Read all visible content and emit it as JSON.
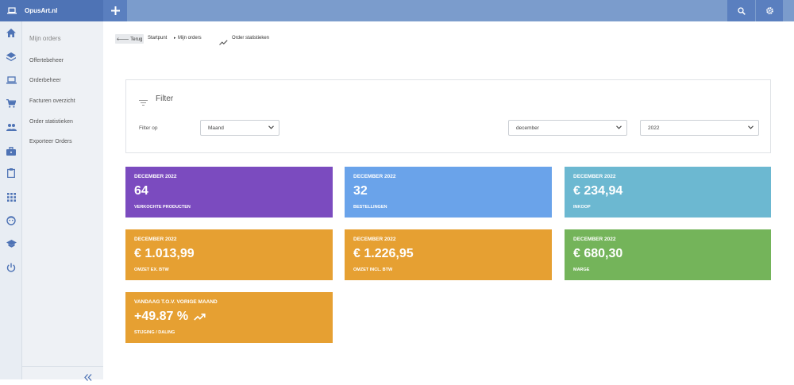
{
  "app": {
    "brand": "OpusArt.nl"
  },
  "topbar": {
    "add_icon": "plus-icon",
    "search_icon": "search-icon",
    "settings_icon": "gear-icon"
  },
  "rail": [
    "home-icon",
    "layers-icon",
    "laptop-icon",
    "cart-icon",
    "users-icon",
    "briefcase-icon",
    "clipboard-icon",
    "apps-icon",
    "face-icon",
    "school-icon",
    "power-icon"
  ],
  "subnav": {
    "title": "Mijn orders",
    "items": [
      "Offertebeheer",
      "Orderbeheer",
      "Facturen overzicht",
      "Order statistieken",
      "Exporteer Orders"
    ],
    "collapse_icon": "double-chevron-left-icon"
  },
  "breadcrumb": {
    "back": "🡐 Terug",
    "crumbs": [
      "Startpunt",
      "Mijn orders"
    ],
    "separator": "▸",
    "current": "Order statistieken"
  },
  "filter": {
    "title": "Filter",
    "label": "Filter op",
    "period_type": "Maand",
    "month": "december",
    "year": "2022"
  },
  "tiles": [
    {
      "period": "DECEMBER 2022",
      "value": "64",
      "label": "VERKOCHTE PRODUCTEN",
      "color": "#7b4bbf"
    },
    {
      "period": "DECEMBER 2022",
      "value": "32",
      "label": "BESTELLINGEN",
      "color": "#6aa3ea"
    },
    {
      "period": "DECEMBER 2022",
      "value": "€ 234,94",
      "label": "INKOOP",
      "color": "#6cb8d1"
    },
    {
      "period": "DECEMBER 2022",
      "value": "€ 1.013,99",
      "label": "OMZET EX. BTW",
      "color": "#e6a032"
    },
    {
      "period": "DECEMBER 2022",
      "value": "€ 1.226,95",
      "label": "OMZET INCL. BTW",
      "color": "#e6a032"
    },
    {
      "period": "DECEMBER 2022",
      "value": "€ 680,30",
      "label": "MARGE",
      "color": "#74b45a"
    },
    {
      "period": "VANDAAG T.O.V. VORIGE MAAND",
      "value": "+49.87 %",
      "label": "STIJGING / DALING",
      "color": "#e6a032"
    }
  ]
}
